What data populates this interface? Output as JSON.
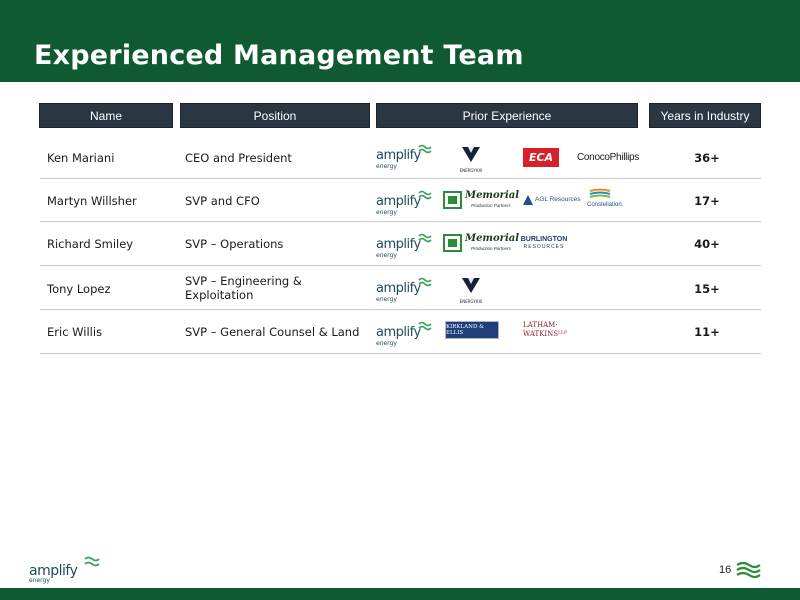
{
  "title": "Experienced Management Team",
  "headers": {
    "name": "Name",
    "position": "Position",
    "prior": "Prior Experience",
    "years": "Years in Industry"
  },
  "rows": [
    {
      "name": "Ken Mariani",
      "position": "CEO and President",
      "years": "36+",
      "logos": [
        "amplify-energy-logo",
        "energy-xxi-logo",
        "eca-logo",
        "conocophillips-logo"
      ]
    },
    {
      "name": "Martyn Willsher",
      "position": "SVP and CFO",
      "years": "17+",
      "logos": [
        "amplify-energy-logo",
        "memorial-production-partners-logo",
        "agl-resources-logo",
        "constellation-logo"
      ]
    },
    {
      "name": "Richard Smiley",
      "position": "SVP – Operations",
      "years": "40+",
      "logos": [
        "amplify-energy-logo",
        "memorial-production-partners-logo",
        "burlington-resources-logo"
      ]
    },
    {
      "name": "Tony Lopez",
      "position_line1": "SVP – Engineering &",
      "position_line2": "Exploitation",
      "years": "15+",
      "logos": [
        "amplify-energy-logo",
        "energy-xxi-logo"
      ]
    },
    {
      "name": "Eric Willis",
      "position": "SVP – General Counsel & Land",
      "years": "11+",
      "logos": [
        "amplify-energy-logo",
        "kirkland-ellis-logo",
        "latham-watkins-logo"
      ]
    }
  ],
  "logo_text": {
    "amplify": "amplify",
    "energy": "energy",
    "energy_xxi": "ENERGYXXI",
    "eca": "ECA",
    "conocophillips": "ConocoPhillips",
    "memorial": "Memorial",
    "memorial_sub": "Production Partners",
    "agl": "AGL Resources",
    "constellation": "Constellation.",
    "burlington_1": "BURLINGTON",
    "burlington_2": "RESOURCES",
    "kirkland": "KIRKLAND & ELLIS",
    "latham_1": "LATHAM·",
    "latham_2": "WATKINSᴸᴸᴾ"
  },
  "page_number": "16",
  "colors": {
    "brand_green": "#0f5a32",
    "header_navy": "#2a3742",
    "amplify_teal": "#1e4a5a",
    "amplify_wave": "#3aa35a"
  }
}
